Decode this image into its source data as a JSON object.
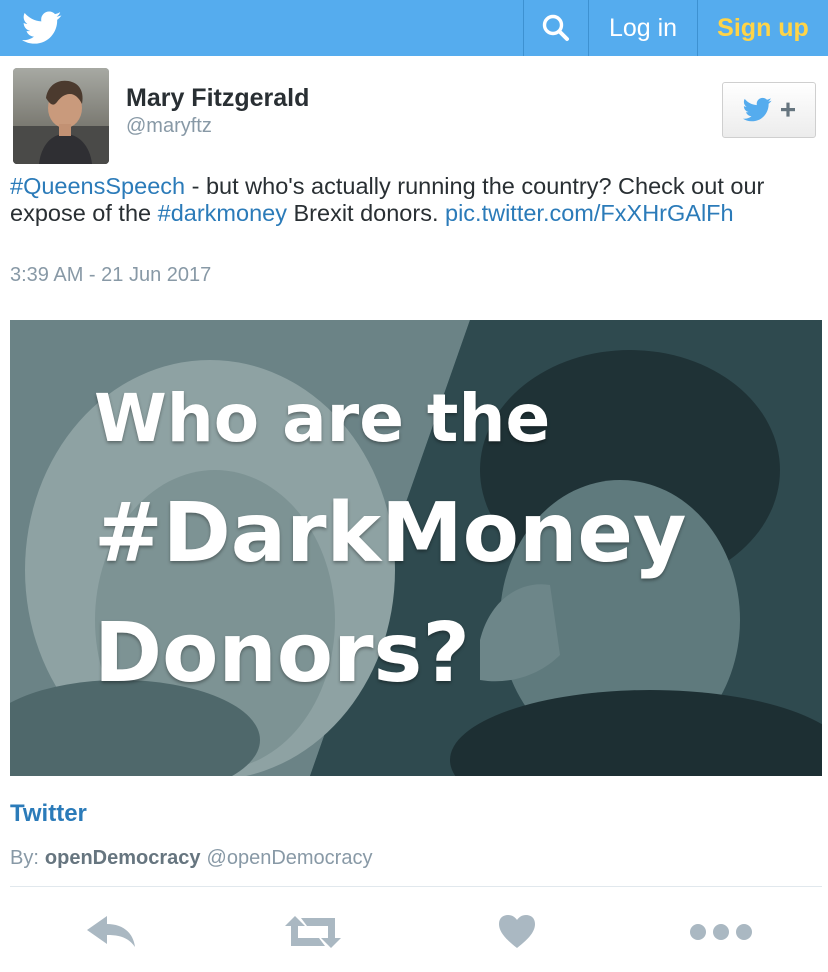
{
  "header": {
    "logo_icon": "twitter-bird-icon",
    "search_icon": "search-icon",
    "login_label": "Log in",
    "signup_label": "Sign up",
    "colors": {
      "bar": "#55acee",
      "signup": "#ffd447"
    }
  },
  "tweet": {
    "author_name": "Mary Fitzgerald",
    "author_handle": "@maryftz",
    "follow_icon": "follow-plus-icon",
    "text_parts": {
      "hashtag1": "#QueensSpeech",
      "t1": " - but who's actually running the country? Check out our expose of the ",
      "hashtag2": "#darkmoney",
      "t2": " Brexit donors. ",
      "link": "pic.twitter.com/FxXHrGAlFh"
    },
    "timestamp": "3:39 AM - 21 Jun 2017"
  },
  "media": {
    "lines": [
      "Who are the",
      "#DarkMoney",
      "Donors?"
    ]
  },
  "card": {
    "title": "Twitter",
    "by_label": "By:",
    "author": "openDemocracy",
    "author_handle": "@openDemocracy"
  },
  "actions": [
    "reply-icon",
    "retweet-icon",
    "like-icon",
    "more-icon"
  ]
}
